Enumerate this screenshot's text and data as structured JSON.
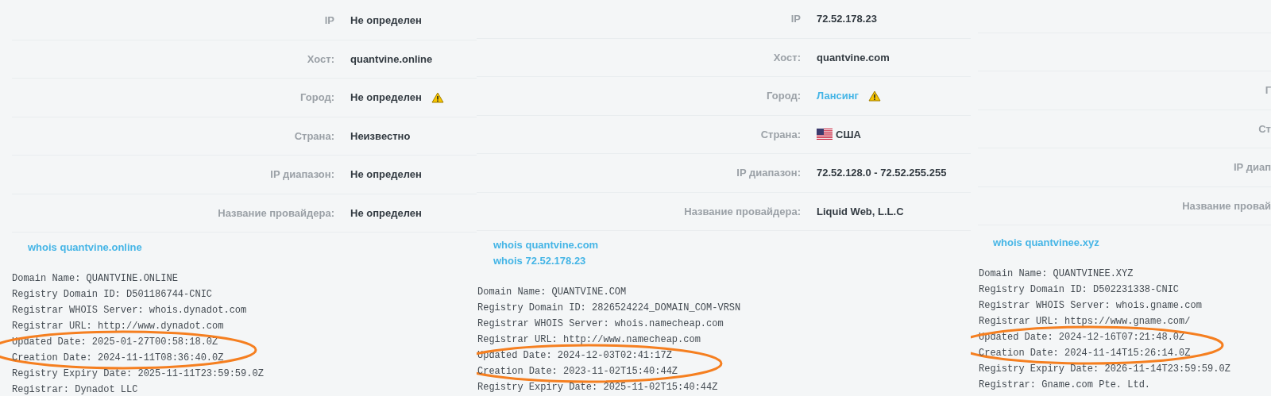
{
  "panels": [
    {
      "rows": [
        {
          "label": "IP",
          "value": "Не определен"
        },
        {
          "label": "Хост:",
          "value": "quantvine.online"
        },
        {
          "label": "Город:",
          "value": "Не определен",
          "warning": true
        },
        {
          "label": "Страна:",
          "value": "Неизвестно"
        },
        {
          "label": "IP диапазон:",
          "value": "Не определен"
        },
        {
          "label": "Название провайдера:",
          "value": "Не определен"
        }
      ],
      "links": [
        "whois quantvine.online"
      ],
      "whois_lines": [
        {
          "text": "Domain Name: QUANTVINE.ONLINE",
          "circled": false
        },
        {
          "text": "Registry Domain ID: D501186744-CNIC",
          "circled": false
        },
        {
          "text": "Registrar WHOIS Server: whois.dynadot.com",
          "circled": false
        },
        {
          "text": "Registrar URL: http://www.dynadot.com",
          "circled": false
        },
        {
          "text": "Updated Date: 2025-01-27T00:58:18.0Z",
          "circled": true
        },
        {
          "text": "Creation Date: 2024-11-11T08:36:40.0Z",
          "circled": true
        },
        {
          "text": "Registry Expiry Date: 2025-11-11T23:59:59.0Z",
          "circled": false
        },
        {
          "text": "Registrar: Dynadot LLC",
          "circled": false
        }
      ]
    },
    {
      "rows": [
        {
          "label": "IP",
          "value": "72.52.178.23"
        },
        {
          "label": "Хост:",
          "value": "quantvine.com"
        },
        {
          "label": "Город:",
          "value": "Лансинг",
          "link": true,
          "warning": true
        },
        {
          "label": "Страна:",
          "value": "США",
          "flag": true
        },
        {
          "label": "IP диапазон:",
          "value": "72.52.128.0 - 72.52.255.255"
        },
        {
          "label": "Название провайдера:",
          "value": "Liquid Web, L.L.C"
        }
      ],
      "links": [
        "whois quantvine.com",
        "whois 72.52.178.23"
      ],
      "whois_lines": [
        {
          "text": "Domain Name: QUANTVINE.COM",
          "circled": false
        },
        {
          "text": "Registry Domain ID: 2826524224_DOMAIN_COM-VRSN",
          "circled": false
        },
        {
          "text": "Registrar WHOIS Server: whois.namecheap.com",
          "circled": false
        },
        {
          "text": "Registrar URL: http://www.namecheap.com",
          "circled": false
        },
        {
          "text": "Updated Date: 2024-12-03T02:41:17Z",
          "circled": true
        },
        {
          "text": "Creation Date: 2023-11-02T15:40:44Z",
          "circled": true
        },
        {
          "text": "Registry Expiry Date: 2025-11-02T15:40:44Z",
          "circled": false
        }
      ]
    },
    {
      "rows": [
        {
          "label": "Г"
        },
        {
          "label": "Ст"
        },
        {
          "label": "IP диап"
        },
        {
          "label": "Название провай"
        }
      ],
      "links": [
        "whois quantvinee.xyz"
      ],
      "whois_lines": [
        {
          "text": "Domain Name: QUANTVINEE.XYZ",
          "circled": false
        },
        {
          "text": "Registry Domain ID: D502231338-CNIC",
          "circled": false
        },
        {
          "text": "Registrar WHOIS Server: whois.gname.com",
          "circled": false
        },
        {
          "text": "Registrar URL: https://www.gname.com/",
          "circled": false
        },
        {
          "text": "Updated Date: 2024-12-16T07:21:48.0Z",
          "circled": true
        },
        {
          "text": "Creation Date: 2024-11-14T15:26:14.0Z",
          "circled": true
        },
        {
          "text": "Registry Expiry Date: 2026-11-14T23:59:59.0Z",
          "circled": false
        },
        {
          "text": "Registrar: Gname.com Pte. Ltd.",
          "circled": false
        }
      ]
    }
  ]
}
